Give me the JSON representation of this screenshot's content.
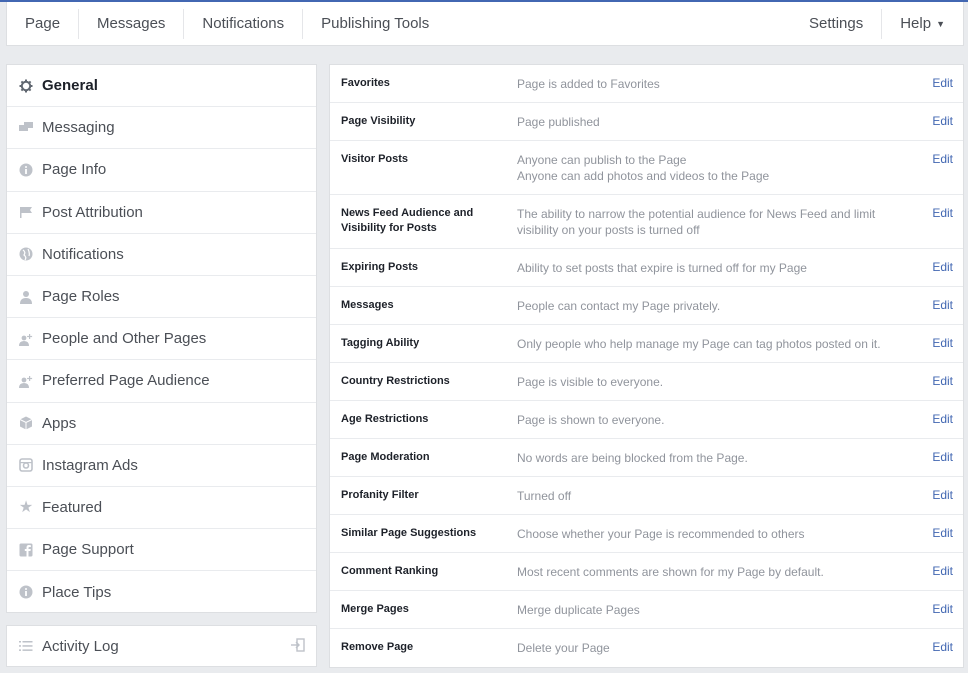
{
  "topnav": {
    "tabs": [
      "Page",
      "Messages",
      "Notifications",
      "Publishing Tools"
    ],
    "settings": "Settings",
    "help": "Help"
  },
  "sidebar": {
    "items": [
      {
        "label": "General",
        "icon": "gear-icon",
        "active": true
      },
      {
        "label": "Messaging",
        "icon": "chat-icon"
      },
      {
        "label": "Page Info",
        "icon": "info-icon"
      },
      {
        "label": "Post Attribution",
        "icon": "flag-icon"
      },
      {
        "label": "Notifications",
        "icon": "globe-icon"
      },
      {
        "label": "Page Roles",
        "icon": "person-icon"
      },
      {
        "label": "People and Other Pages",
        "icon": "people-icon"
      },
      {
        "label": "Preferred Page Audience",
        "icon": "audience-icon"
      },
      {
        "label": "Apps",
        "icon": "cube-icon"
      },
      {
        "label": "Instagram Ads",
        "icon": "instagram-icon"
      },
      {
        "label": "Featured",
        "icon": "star-icon"
      },
      {
        "label": "Page Support",
        "icon": "support-icon"
      },
      {
        "label": "Place Tips",
        "icon": "info-icon"
      }
    ]
  },
  "activity_log": {
    "label": "Activity Log",
    "icon": "list-icon",
    "action_icon": "exit-icon"
  },
  "settings": {
    "edit_label": "Edit",
    "rows": [
      {
        "label": "Favorites",
        "value": "Page is added to Favorites"
      },
      {
        "label": "Page Visibility",
        "value": "Page published"
      },
      {
        "label": "Visitor Posts",
        "value": "Anyone can publish to the Page",
        "value2": "Anyone can add photos and videos to the Page"
      },
      {
        "label": "News Feed Audience and Visibility for Posts",
        "value": "The ability to narrow the potential audience for News Feed and limit visibility on your posts is turned off"
      },
      {
        "label": "Expiring Posts",
        "value": "Ability to set posts that expire is turned off for my Page"
      },
      {
        "label": "Messages",
        "value": "People can contact my Page privately."
      },
      {
        "label": "Tagging Ability",
        "value": "Only people who help manage my Page can tag photos posted on it."
      },
      {
        "label": "Country Restrictions",
        "value": "Page is visible to everyone."
      },
      {
        "label": "Age Restrictions",
        "value": "Page is shown to everyone."
      },
      {
        "label": "Page Moderation",
        "value": "No words are being blocked from the Page."
      },
      {
        "label": "Profanity Filter",
        "value": "Turned off"
      },
      {
        "label": "Similar Page Suggestions",
        "value": "Choose whether your Page is recommended to others"
      },
      {
        "label": "Comment Ranking",
        "value": "Most recent comments are shown for my Page by default."
      },
      {
        "label": "Merge Pages",
        "value": "Merge duplicate Pages"
      },
      {
        "label": "Remove Page",
        "value": "Delete your Page"
      }
    ]
  }
}
